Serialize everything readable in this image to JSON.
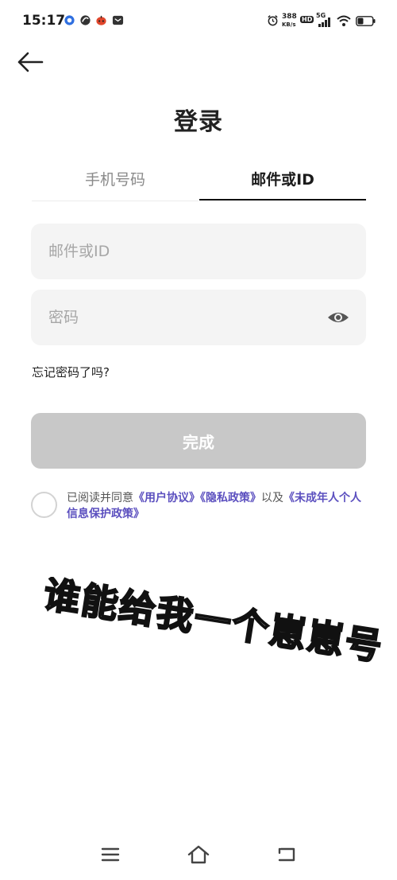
{
  "status_bar": {
    "time": "15:17",
    "net_speed": "388",
    "net_unit": "KB/s",
    "hd_badge": "HD",
    "network_type": "5G",
    "icons": [
      "app-circle-icon",
      "app-swirl-icon",
      "app-ladybug-icon",
      "message-icon",
      "alarm-icon",
      "signal-icon",
      "wifi-icon",
      "battery-icon"
    ]
  },
  "header": {
    "back_icon": "back-arrow-icon",
    "title": "登录"
  },
  "tabs": [
    {
      "label": "手机号码",
      "active": false
    },
    {
      "label": "邮件或ID",
      "active": true
    }
  ],
  "form": {
    "email_placeholder": "邮件或ID",
    "email_value": "",
    "password_placeholder": "密码",
    "password_value": "",
    "eye_icon": "eye-icon",
    "forgot_label": "忘记密码了吗?",
    "submit_label": "完成"
  },
  "agreement": {
    "prefix": "已阅读并同意",
    "user_agreement": "《用户协议》",
    "privacy_policy": "《隐私政策》",
    "and": "以及",
    "minor_policy": "《未成年人个人信息保护政策》",
    "checked": false
  },
  "overlay": {
    "text": "谁能给我一个崽崽号"
  },
  "nav_bar": {
    "icons": [
      "menu-icon",
      "home-icon",
      "return-icon"
    ]
  },
  "colors": {
    "link": "#5b4fbf",
    "button_disabled": "#c8c8c8",
    "input_bg": "#f4f4f4",
    "tab_active": "#111111"
  }
}
